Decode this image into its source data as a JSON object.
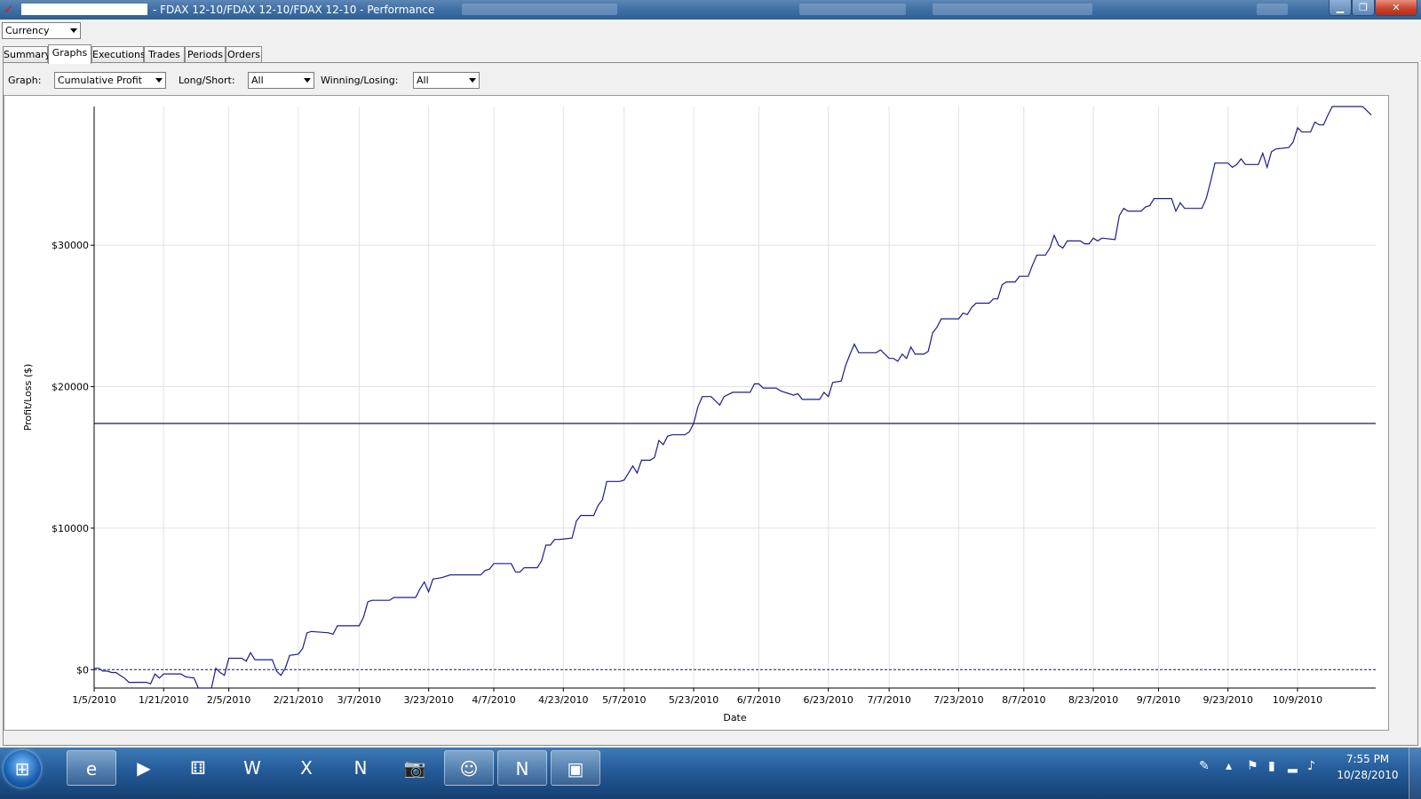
{
  "window": {
    "title": "- FDAX 12-10/FDAX 12-10/FDAX 12-10 - Performance",
    "app_icon": "ninja-logo-icon"
  },
  "toolbar": {
    "currency_combo": "Currency"
  },
  "tabs": [
    {
      "label": "Summary",
      "active": false
    },
    {
      "label": "Graphs",
      "active": true
    },
    {
      "label": "Executions",
      "active": false
    },
    {
      "label": "Trades",
      "active": false
    },
    {
      "label": "Periods",
      "active": false
    },
    {
      "label": "Orders",
      "active": false
    }
  ],
  "filters": {
    "graph_label": "Graph:",
    "graph_value": "Cumulative Profit",
    "longshort_label": "Long/Short:",
    "longshort_value": "All",
    "winlose_label": "Winning/Losing:",
    "winlose_value": "All"
  },
  "chart_data": {
    "type": "line",
    "xlabel": "Date",
    "ylabel": "Profit/Loss ($)",
    "x_tick_labels": [
      "1/5/2010",
      "1/21/2010",
      "2/5/2010",
      "2/21/2010",
      "3/7/2010",
      "3/23/2010",
      "4/7/2010",
      "4/23/2010",
      "5/7/2010",
      "5/23/2010",
      "6/7/2010",
      "6/23/2010",
      "7/7/2010",
      "7/23/2010",
      "8/7/2010",
      "8/23/2010",
      "9/7/2010",
      "9/23/2010",
      "10/9/2010"
    ],
    "y_tick_labels": [
      "$0",
      "$10000",
      "$20000",
      "$30000"
    ],
    "y_ticks": [
      0,
      10000,
      20000,
      30000
    ],
    "ylim": [
      -1300,
      39800
    ],
    "x_range": [
      "2010-01-05",
      "2010-10-27"
    ],
    "grid": true,
    "line_color": "#1c1c8c",
    "reference_lines": [
      {
        "value": 0,
        "style": "dashed"
      },
      {
        "value": 17400,
        "style": "solid"
      }
    ],
    "series": [
      {
        "points": [
          [
            "2010-01-05",
            100
          ],
          [
            "2010-01-06",
            100
          ],
          [
            "2010-01-07",
            -100
          ],
          [
            "2010-01-08",
            -100
          ],
          [
            "2010-01-09",
            -200
          ],
          [
            "2010-01-10",
            -200
          ],
          [
            "2010-01-11",
            -400
          ],
          [
            "2010-01-12",
            -600
          ],
          [
            "2010-01-13",
            -900
          ],
          [
            "2010-01-14",
            -900
          ],
          [
            "2010-01-17",
            -900
          ],
          [
            "2010-01-18",
            -1000
          ],
          [
            "2010-01-19",
            -300
          ],
          [
            "2010-01-20",
            -600
          ],
          [
            "2010-01-21",
            -300
          ],
          [
            "2010-01-23",
            -300
          ],
          [
            "2010-01-25",
            -300
          ],
          [
            "2010-01-26",
            -500
          ],
          [
            "2010-01-28",
            -600
          ],
          [
            "2010-01-29",
            -1300
          ],
          [
            "2010-02-01",
            -1300
          ],
          [
            "2010-02-02",
            100
          ],
          [
            "2010-02-03",
            -200
          ],
          [
            "2010-02-04",
            -400
          ],
          [
            "2010-02-05",
            800
          ],
          [
            "2010-02-07",
            800
          ],
          [
            "2010-02-08",
            800
          ],
          [
            "2010-02-09",
            600
          ],
          [
            "2010-02-10",
            1200
          ],
          [
            "2010-02-11",
            700
          ],
          [
            "2010-02-15",
            700
          ],
          [
            "2010-02-16",
            -100
          ],
          [
            "2010-02-17",
            -400
          ],
          [
            "2010-02-18",
            100
          ],
          [
            "2010-02-19",
            1000
          ],
          [
            "2010-02-21",
            1100
          ],
          [
            "2010-02-22",
            1500
          ],
          [
            "2010-02-23",
            2600
          ],
          [
            "2010-02-24",
            2700
          ],
          [
            "2010-02-28",
            2600
          ],
          [
            "2010-03-01",
            2500
          ],
          [
            "2010-03-02",
            3100
          ],
          [
            "2010-03-05",
            3100
          ],
          [
            "2010-03-07",
            3100
          ],
          [
            "2010-03-08",
            3700
          ],
          [
            "2010-03-09",
            4800
          ],
          [
            "2010-03-10",
            4900
          ],
          [
            "2010-03-14",
            4900
          ],
          [
            "2010-03-15",
            5100
          ],
          [
            "2010-03-17",
            5100
          ],
          [
            "2010-03-20",
            5100
          ],
          [
            "2010-03-21",
            5700
          ],
          [
            "2010-03-22",
            6200
          ],
          [
            "2010-03-23",
            5500
          ],
          [
            "2010-03-24",
            6400
          ],
          [
            "2010-03-26",
            6500
          ],
          [
            "2010-03-28",
            6700
          ],
          [
            "2010-04-04",
            6700
          ],
          [
            "2010-04-05",
            7000
          ],
          [
            "2010-04-06",
            7100
          ],
          [
            "2010-04-07",
            7500
          ],
          [
            "2010-04-11",
            7500
          ],
          [
            "2010-04-12",
            6900
          ],
          [
            "2010-04-13",
            6900
          ],
          [
            "2010-04-14",
            7200
          ],
          [
            "2010-04-17",
            7200
          ],
          [
            "2010-04-18",
            7700
          ],
          [
            "2010-04-19",
            8800
          ],
          [
            "2010-04-20",
            8800
          ],
          [
            "2010-04-21",
            9200
          ],
          [
            "2010-04-22",
            9200
          ],
          [
            "2010-04-25",
            9300
          ],
          [
            "2010-04-26",
            10500
          ],
          [
            "2010-04-27",
            10900
          ],
          [
            "2010-04-28",
            10900
          ],
          [
            "2010-04-30",
            10900
          ],
          [
            "2010-05-01",
            11600
          ],
          [
            "2010-05-02",
            12000
          ],
          [
            "2010-05-03",
            13300
          ],
          [
            "2010-05-06",
            13300
          ],
          [
            "2010-05-07",
            13400
          ],
          [
            "2010-05-08",
            13900
          ],
          [
            "2010-05-09",
            14400
          ],
          [
            "2010-05-10",
            13900
          ],
          [
            "2010-05-11",
            14800
          ],
          [
            "2010-05-13",
            14800
          ],
          [
            "2010-05-14",
            15000
          ],
          [
            "2010-05-15",
            16200
          ],
          [
            "2010-05-16",
            15900
          ],
          [
            "2010-05-17",
            16500
          ],
          [
            "2010-05-18",
            16600
          ],
          [
            "2010-05-21",
            16600
          ],
          [
            "2010-05-22",
            16800
          ],
          [
            "2010-05-23",
            17400
          ],
          [
            "2010-05-24",
            18600
          ],
          [
            "2010-05-25",
            19300
          ],
          [
            "2010-05-27",
            19300
          ],
          [
            "2010-05-29",
            18700
          ],
          [
            "2010-05-30",
            19300
          ],
          [
            "2010-06-01",
            19600
          ],
          [
            "2010-06-05",
            19600
          ],
          [
            "2010-06-06",
            20200
          ],
          [
            "2010-06-07",
            20200
          ],
          [
            "2010-06-08",
            19900
          ],
          [
            "2010-06-11",
            19900
          ],
          [
            "2010-06-12",
            19700
          ],
          [
            "2010-06-14",
            19500
          ],
          [
            "2010-06-15",
            19400
          ],
          [
            "2010-06-16",
            19500
          ],
          [
            "2010-06-17",
            19100
          ],
          [
            "2010-06-21",
            19100
          ],
          [
            "2010-06-22",
            19600
          ],
          [
            "2010-06-23",
            19300
          ],
          [
            "2010-06-24",
            20300
          ],
          [
            "2010-06-26",
            20400
          ],
          [
            "2010-06-27",
            21500
          ],
          [
            "2010-06-28",
            22300
          ],
          [
            "2010-06-29",
            23000
          ],
          [
            "2010-06-30",
            22400
          ],
          [
            "2010-07-04",
            22400
          ],
          [
            "2010-07-05",
            22600
          ],
          [
            "2010-07-06",
            22300
          ],
          [
            "2010-07-07",
            22000
          ],
          [
            "2010-07-08",
            22000
          ],
          [
            "2010-07-09",
            21800
          ],
          [
            "2010-07-10",
            22300
          ],
          [
            "2010-07-11",
            22000
          ],
          [
            "2010-07-12",
            22800
          ],
          [
            "2010-07-13",
            22300
          ],
          [
            "2010-07-15",
            22300
          ],
          [
            "2010-07-16",
            22500
          ],
          [
            "2010-07-17",
            23800
          ],
          [
            "2010-07-18",
            24200
          ],
          [
            "2010-07-19",
            24800
          ],
          [
            "2010-07-23",
            24800
          ],
          [
            "2010-07-24",
            25200
          ],
          [
            "2010-07-25",
            25100
          ],
          [
            "2010-07-26",
            25600
          ],
          [
            "2010-07-27",
            25900
          ],
          [
            "2010-07-30",
            25900
          ],
          [
            "2010-07-31",
            26200
          ],
          [
            "2010-08-01",
            26200
          ],
          [
            "2010-08-02",
            27200
          ],
          [
            "2010-08-03",
            27400
          ],
          [
            "2010-08-05",
            27400
          ],
          [
            "2010-08-06",
            27800
          ],
          [
            "2010-08-08",
            27800
          ],
          [
            "2010-08-09",
            28600
          ],
          [
            "2010-08-10",
            29300
          ],
          [
            "2010-08-12",
            29300
          ],
          [
            "2010-08-13",
            29800
          ],
          [
            "2010-08-14",
            30700
          ],
          [
            "2010-08-15",
            30000
          ],
          [
            "2010-08-16",
            29800
          ],
          [
            "2010-08-17",
            30300
          ],
          [
            "2010-08-20",
            30300
          ],
          [
            "2010-08-21",
            30100
          ],
          [
            "2010-08-22",
            30100
          ],
          [
            "2010-08-23",
            30500
          ],
          [
            "2010-08-24",
            30300
          ],
          [
            "2010-08-25",
            30500
          ],
          [
            "2010-08-28",
            30400
          ],
          [
            "2010-08-29",
            32100
          ],
          [
            "2010-08-30",
            32600
          ],
          [
            "2010-08-31",
            32400
          ],
          [
            "2010-09-03",
            32400
          ],
          [
            "2010-09-04",
            32700
          ],
          [
            "2010-09-05",
            32800
          ],
          [
            "2010-09-06",
            33300
          ],
          [
            "2010-09-10",
            33300
          ],
          [
            "2010-09-11",
            32400
          ],
          [
            "2010-09-12",
            33000
          ],
          [
            "2010-09-13",
            32600
          ],
          [
            "2010-09-17",
            32600
          ],
          [
            "2010-09-18",
            33300
          ],
          [
            "2010-09-19",
            34500
          ],
          [
            "2010-09-20",
            35800
          ],
          [
            "2010-09-23",
            35800
          ],
          [
            "2010-09-24",
            35500
          ],
          [
            "2010-09-25",
            35700
          ],
          [
            "2010-09-26",
            36100
          ],
          [
            "2010-09-27",
            35700
          ],
          [
            "2010-09-30",
            35700
          ],
          [
            "2010-10-01",
            36500
          ],
          [
            "2010-10-02",
            35500
          ],
          [
            "2010-10-03",
            36600
          ],
          [
            "2010-10-04",
            36800
          ],
          [
            "2010-10-07",
            36900
          ],
          [
            "2010-10-08",
            37300
          ],
          [
            "2010-10-09",
            38300
          ],
          [
            "2010-10-10",
            38000
          ],
          [
            "2010-10-12",
            38000
          ],
          [
            "2010-10-13",
            38700
          ],
          [
            "2010-10-14",
            38500
          ],
          [
            "2010-10-15",
            38500
          ],
          [
            "2010-10-16",
            39200
          ],
          [
            "2010-10-17",
            39800
          ],
          [
            "2010-10-24",
            39800
          ],
          [
            "2010-10-25",
            39500
          ],
          [
            "2010-10-26",
            39200
          ]
        ]
      }
    ]
  },
  "taskbar": {
    "items": [
      {
        "name": "internet-explorer-icon",
        "glyph": "e",
        "open": true
      },
      {
        "name": "media-player-icon",
        "glyph": "▶",
        "open": false
      },
      {
        "name": "dice-app-icon",
        "glyph": "⚅",
        "open": false
      },
      {
        "name": "word-icon",
        "glyph": "W",
        "open": false
      },
      {
        "name": "excel-icon",
        "glyph": "X",
        "open": false
      },
      {
        "name": "ninjatrader-icon",
        "glyph": "N",
        "open": false
      },
      {
        "name": "camera-icon",
        "glyph": "📷",
        "open": false
      },
      {
        "name": "messenger-icon",
        "glyph": "☺",
        "open": true
      },
      {
        "name": "ninjatrader-window-icon",
        "glyph": "N",
        "open": true
      },
      {
        "name": "photo-viewer-icon",
        "glyph": "▣",
        "open": true
      }
    ],
    "clock_time": "7:55 PM",
    "clock_date": "10/28/2010"
  },
  "colors": {
    "titlebar": "#3f6fa4",
    "taskbar": "#245b98",
    "close_button": "#c8402a",
    "chart_line": "#1c1c8c"
  }
}
